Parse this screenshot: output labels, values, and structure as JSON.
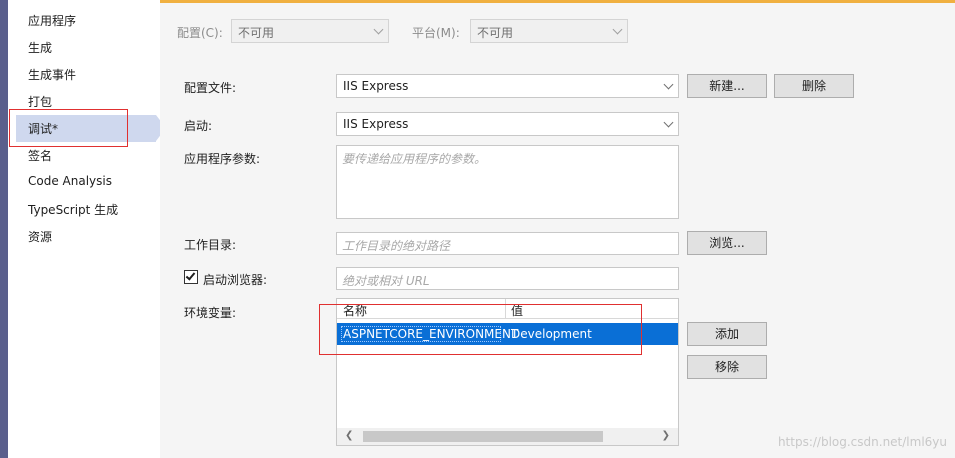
{
  "sidebar": {
    "items": [
      {
        "label": "应用程序"
      },
      {
        "label": "生成"
      },
      {
        "label": "生成事件"
      },
      {
        "label": "打包"
      },
      {
        "label": "调试*"
      },
      {
        "label": "签名"
      },
      {
        "label": "Code Analysis"
      },
      {
        "label": "TypeScript 生成"
      },
      {
        "label": "资源"
      }
    ],
    "selected_index": 4
  },
  "config_bar": {
    "config_label": "配置(C):",
    "config_value": "不可用",
    "platform_label": "平台(M):",
    "platform_value": "不可用"
  },
  "profile": {
    "label": "配置文件:",
    "value": "IIS Express",
    "new_button": "新建...",
    "delete_button": "删除"
  },
  "launch": {
    "label": "启动:",
    "value": "IIS Express"
  },
  "app_args": {
    "label": "应用程序参数:",
    "placeholder": "要传递给应用程序的参数。"
  },
  "working_dir": {
    "label": "工作目录:",
    "placeholder": "工作目录的绝对路径",
    "browse_button": "浏览..."
  },
  "launch_browser": {
    "label": "启动浏览器:",
    "checked": true,
    "placeholder": "绝对或相对 URL"
  },
  "env_vars": {
    "label": "环境变量:",
    "columns": [
      "名称",
      "值"
    ],
    "rows": [
      {
        "name": "ASPNETCORE_ENVIRONMENT",
        "value": "Development"
      }
    ],
    "add_button": "添加",
    "remove_button": "移除"
  },
  "watermark": "https://blog.csdn.net/lml6yu",
  "colors": {
    "selection": "#0a6fd6",
    "sidebar_selected": "#cfd8ee",
    "annotation": "#e03030",
    "accent_top": "#f0b040"
  }
}
